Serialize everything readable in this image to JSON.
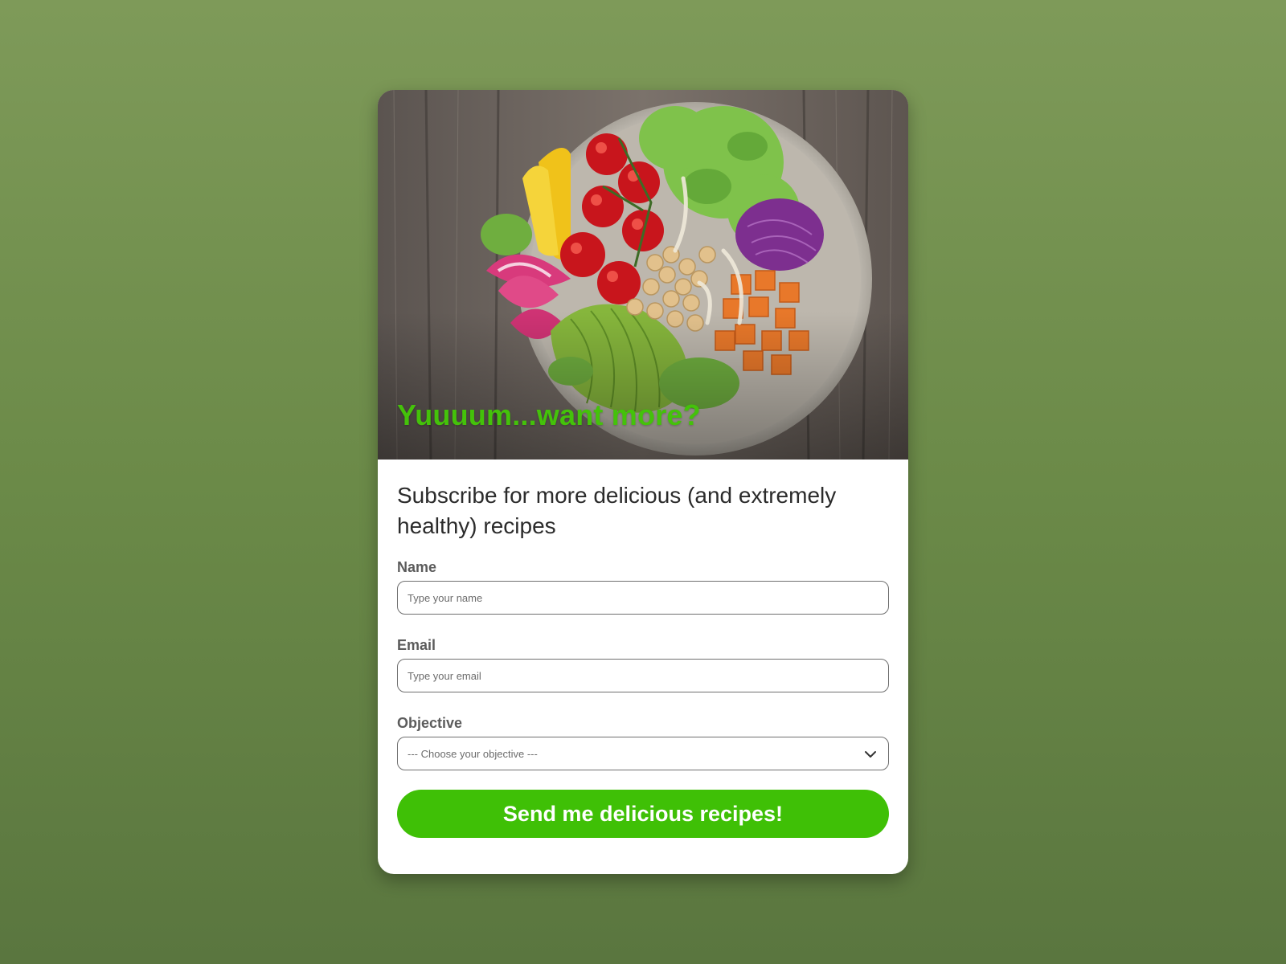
{
  "hero": {
    "title": "Yuuuum...want more?",
    "image_description_icon": "salad-bowl-image"
  },
  "form": {
    "headline": "Subscribe for more delicious (and extremely healthy) recipes",
    "name": {
      "label": "Name",
      "placeholder": "Type your name",
      "value": ""
    },
    "email": {
      "label": "Email",
      "placeholder": "Type your email",
      "value": ""
    },
    "objective": {
      "label": "Objective",
      "selected": "--- Choose your objective ---",
      "icon": "chevron-down-icon"
    },
    "submit_label": "Send me delicious recipes!"
  },
  "colors": {
    "background": "#6b8a48",
    "accent": "#3fc006",
    "hero_title": "#44c20a",
    "card": "#ffffff"
  }
}
